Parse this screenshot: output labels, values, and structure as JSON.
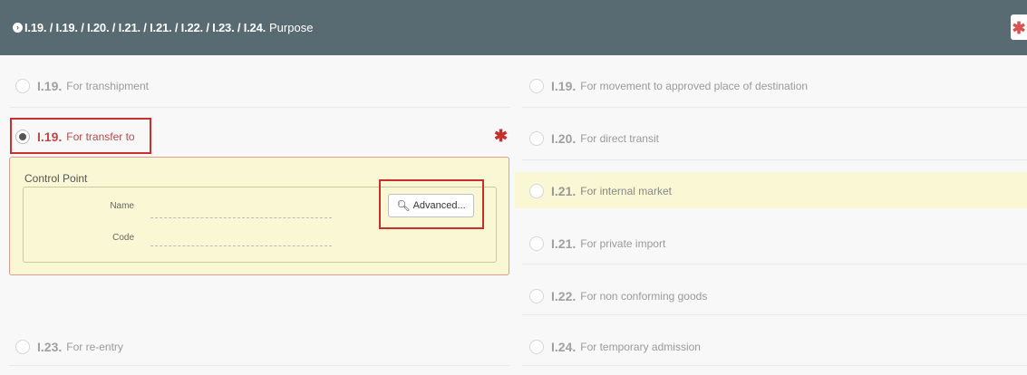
{
  "header": {
    "codes": "I.19. / I.19. / I.20. / I.21. / I.21. / I.22. / I.23. / I.24.",
    "title": "Purpose",
    "required_mark": "✱"
  },
  "left_options": [
    {
      "code": "I.19.",
      "label": "For transhipment",
      "selected": false
    },
    {
      "code": "I.19.",
      "label": "For transfer to",
      "selected": true
    },
    {
      "code": "I.23.",
      "label": "For re-entry",
      "selected": false
    }
  ],
  "right_options": [
    {
      "code": "I.19.",
      "label": "For movement to approved place of destination"
    },
    {
      "code": "I.20.",
      "label": "For direct transit"
    },
    {
      "code": "I.21.",
      "label": "For internal market",
      "highlighted": true
    },
    {
      "code": "I.21.",
      "label": "For private import"
    },
    {
      "code": "I.22.",
      "label": "For non conforming goods"
    },
    {
      "code": "I.24.",
      "label": "For temporary admission"
    }
  ],
  "control_point": {
    "legend": "Control Point",
    "name_label": "Name",
    "code_label": "Code",
    "name_value": "",
    "code_value": "",
    "advanced_button": "Advanced..."
  },
  "required_star": "✱",
  "colors": {
    "header_bg": "#586b72",
    "error_red": "#c9302c",
    "panel_bg": "#f9f7d4"
  }
}
